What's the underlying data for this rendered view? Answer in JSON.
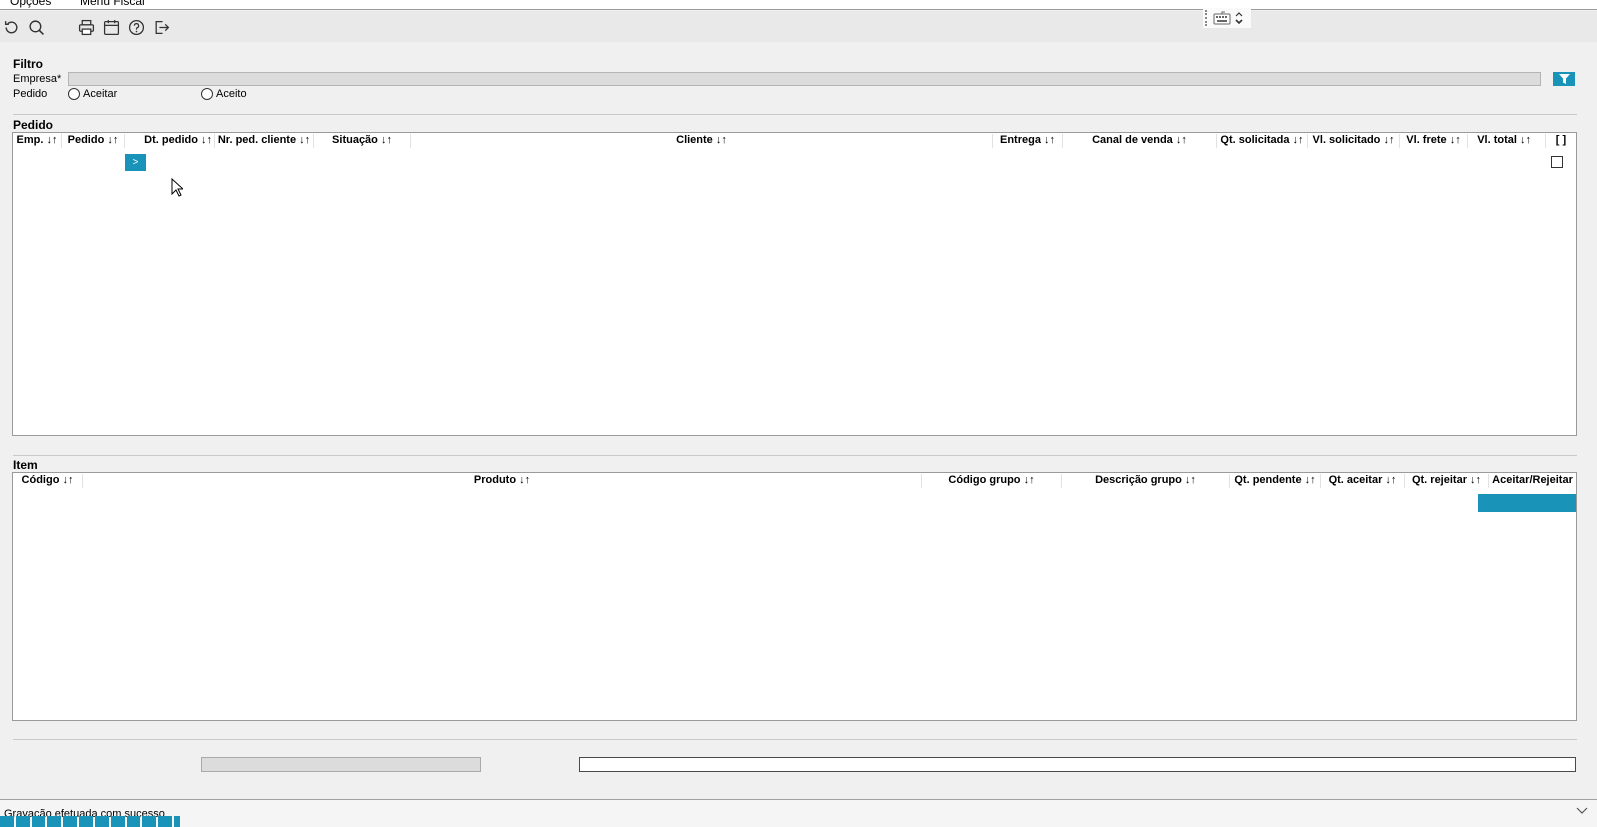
{
  "menu": {
    "items": [
      {
        "label": "Opções"
      },
      {
        "label": "Menu Fiscal"
      }
    ]
  },
  "toolbar": {
    "buttons": [
      {
        "icon": "refresh-icon"
      },
      {
        "icon": "search-icon"
      },
      {
        "icon": "print-icon"
      },
      {
        "icon": "calendar-icon"
      },
      {
        "icon": "help-icon"
      },
      {
        "icon": "exit-icon"
      }
    ]
  },
  "filtro": {
    "title": "Filtro",
    "empresa_label": "Empresa*",
    "empresa_value": "",
    "pedido_label": "Pedido",
    "radio_aceitar": "Aceitar",
    "radio_aceito": "Aceito"
  },
  "pedido": {
    "title": "Pedido",
    "columns": [
      "Emp. ↓↑",
      "Pedido ↓↑",
      "Dt. pedido ↓↑",
      "Nr. ped. cliente ↓↑",
      "Situação ↓↑",
      "Cliente ↓↑",
      "Entrega ↓↑",
      "Canal de venda ↓↑",
      "Qt. solicitada ↓↑",
      "Vl. solicitado ↓↑",
      "Vl. frete ↓↑",
      "Vl. total ↓↑",
      "[ ]"
    ],
    "next_button": ">"
  },
  "item": {
    "title": "Item",
    "columns": [
      "Código ↓↑",
      "Produto ↓↑",
      "Código grupo ↓↑",
      "Descrição grupo ↓↑",
      "Qt. pendente ↓↑",
      "Qt. aceitar ↓↑",
      "Qt. rejeitar ↓↑",
      "Aceitar/Rejeitar"
    ]
  },
  "status": {
    "message": "Gravação efetuada com sucesso"
  },
  "colors": {
    "accent": "#1a93b8"
  }
}
